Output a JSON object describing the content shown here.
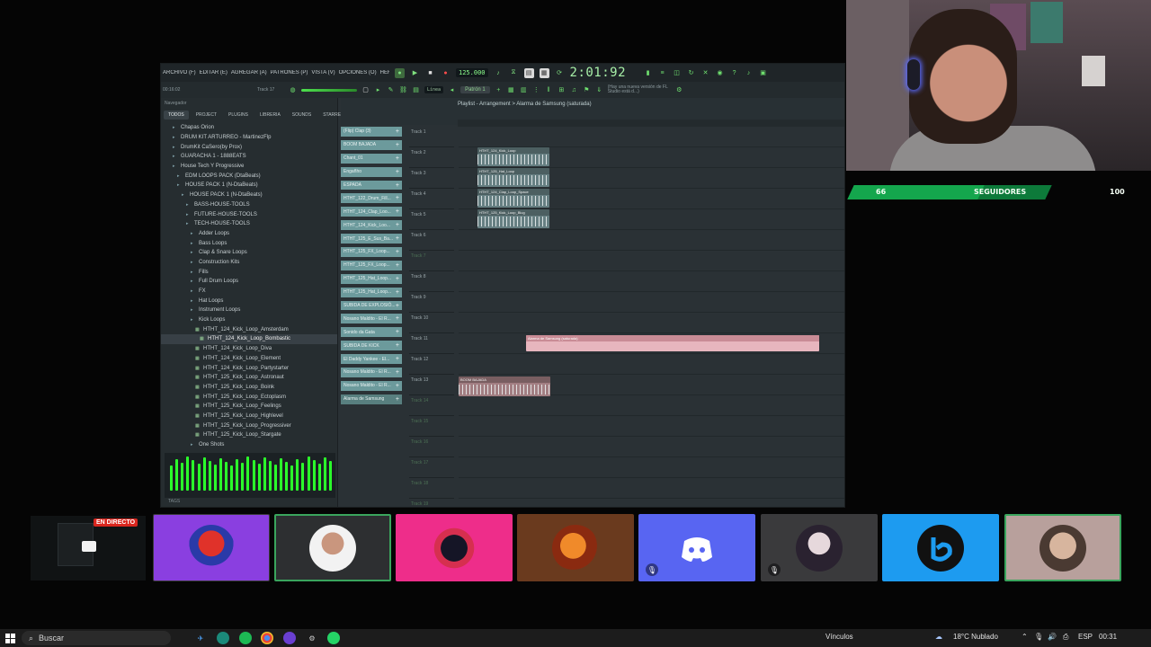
{
  "fl": {
    "menu": [
      "ARCHIVO (F)",
      "EDITAR (E)",
      "AGREGAR (A)",
      "PATRONES (P)",
      "VISTA (V)",
      "OPCIONES (O)",
      "HERRAMIENTAS (T)",
      "AYUDA"
    ],
    "tempo": "125.000",
    "time": "2:01:92",
    "subtime": "00:16:02",
    "track_hint": "Track 17",
    "pattern": "Patrón 1",
    "line_mode": "Línea",
    "update_notice": "(Hay una nueva versión de FL Studio está d...)",
    "browser_header": "Navegador",
    "browser_tabs": [
      "TODOS",
      "PROJECT",
      "PLUGINS",
      "LIBRERIA",
      "SOUNDS",
      "STARRED"
    ],
    "tree": [
      {
        "label": "Chapas Orion",
        "indent": 1,
        "type": "folder"
      },
      {
        "label": "DRUM KIT ARTURREO - MartinezFlp",
        "indent": 1,
        "type": "folder"
      },
      {
        "label": "DrumKit CaSero(by Prox)",
        "indent": 1,
        "type": "folder"
      },
      {
        "label": "GUARACHA 1 - 1888EATS",
        "indent": 1,
        "type": "folder"
      },
      {
        "label": "House Tech Y Progressive",
        "indent": 1,
        "type": "folder"
      },
      {
        "label": "EDM LOOPS PACK (DtaBeats)",
        "indent": 2,
        "type": "folder"
      },
      {
        "label": "HOUSE PACK 1 (N-DtaBeats)",
        "indent": 2,
        "type": "folder"
      },
      {
        "label": "HOUSE PACK 1 (N-DtaBeats)",
        "indent": 3,
        "type": "folder"
      },
      {
        "label": "BASS-HOUSE-TOOLS",
        "indent": 4,
        "type": "folder"
      },
      {
        "label": "FUTURE-HOUSE-TOOLS",
        "indent": 4,
        "type": "folder"
      },
      {
        "label": "TECH-HOUSE-TOOLS",
        "indent": 4,
        "type": "folder"
      },
      {
        "label": "Adder Loops",
        "indent": 5,
        "type": "folder"
      },
      {
        "label": "Bass Loops",
        "indent": 5,
        "type": "folder"
      },
      {
        "label": "Clap & Snare Loops",
        "indent": 5,
        "type": "folder"
      },
      {
        "label": "Construction Kits",
        "indent": 5,
        "type": "folder"
      },
      {
        "label": "Fills",
        "indent": 5,
        "type": "folder"
      },
      {
        "label": "Full Drum Loops",
        "indent": 5,
        "type": "folder"
      },
      {
        "label": "FX",
        "indent": 5,
        "type": "folder"
      },
      {
        "label": "Hat Loops",
        "indent": 5,
        "type": "folder"
      },
      {
        "label": "Instrument Loops",
        "indent": 5,
        "type": "folder"
      },
      {
        "label": "Kick Loops",
        "indent": 5,
        "type": "folder"
      },
      {
        "label": "HTHT_124_Kick_Loop_Amsterdam",
        "indent": 6,
        "type": "file"
      },
      {
        "label": "HTHT_124_Kick_Loop_Bombastic",
        "indent": 7,
        "type": "file",
        "highlight": true
      },
      {
        "label": "HTHT_124_Kick_Loop_Diva",
        "indent": 6,
        "type": "file"
      },
      {
        "label": "HTHT_124_Kick_Loop_Element",
        "indent": 6,
        "type": "file"
      },
      {
        "label": "HTHT_124_Kick_Loop_Partystarter",
        "indent": 6,
        "type": "file"
      },
      {
        "label": "HTHT_125_Kick_Loop_Astronaut",
        "indent": 6,
        "type": "file"
      },
      {
        "label": "HTHT_125_Kick_Loop_Boink",
        "indent": 6,
        "type": "file"
      },
      {
        "label": "HTHT_125_Kick_Loop_Ectoplasm",
        "indent": 6,
        "type": "file"
      },
      {
        "label": "HTHT_125_Kick_Loop_Feelings",
        "indent": 6,
        "type": "file"
      },
      {
        "label": "HTHT_125_Kick_Loop_Highlevel",
        "indent": 6,
        "type": "file"
      },
      {
        "label": "HTHT_125_Kick_Loop_Progressiver",
        "indent": 6,
        "type": "file"
      },
      {
        "label": "HTHT_125_Kick_Loop_Stargate",
        "indent": 6,
        "type": "file"
      },
      {
        "label": "One Shots",
        "indent": 5,
        "type": "folder"
      }
    ],
    "tag_label": "TAGS",
    "clips": [
      "(Flip) Clap (3)",
      "BOOM BAJADA",
      "Chant_01",
      "Engañho",
      "ESPADA",
      "HTHT_122_Drum_Fill...",
      "HTHT_124_Clap_Loo...",
      "HTHT_124_Kick_Loo...",
      "HTHT_125_E_Sus_Ba...",
      "HTHT_125_FX_Loop...",
      "HTHT_125_FX_Loop...",
      "HTHT_125_Hat_Loop...",
      "HTHT_125_Hat_Loop...",
      "SUBIDA DE EXPLOSIÓ...",
      "Nosano Maldito - El R...",
      "Sonido da Gata",
      "SUBIDA DE KICK",
      "El Daddy Yankee - El...",
      "Nosano Maldito - El R...",
      "Nosano Maldito - El R...",
      "Alarma de Samsung"
    ],
    "playlist_title": "Playlist - Arrangement > Alarma de Samsung (saturada)",
    "tracks": [
      "Track 1",
      "Track 2",
      "Track 3",
      "Track 4",
      "Track 5",
      "Track 6",
      "Track 7",
      "Track 8",
      "Track 9",
      "Track 10",
      "Track 11",
      "Track 12",
      "Track 13",
      "Track 14",
      "Track 15",
      "Track 16",
      "Track 17",
      "Track 18",
      "Track 19"
    ],
    "playlist_clips": {
      "c1": "HTHT_124_Kick_Loop",
      "c2": "HTHT_125_Hat_Loop",
      "c3": "HTHT_124_Clap_Loop_Space",
      "c4": "HTHT_125_Kick_Loop_Blug",
      "c5": "Alarma de Samsung (saturada)",
      "c6": "BOOM BAJADA"
    }
  },
  "overlay": {
    "followers_current": "66",
    "followers_label": "SEGUIDORES",
    "followers_goal": "100",
    "followers_progress": 0.66,
    "live_badge": "EN DIRECTO"
  },
  "taskbar": {
    "search": "Buscar",
    "links": "Vínculos",
    "weather": "18°C Nublado",
    "lang": "ESP",
    "clock": "00:31"
  }
}
